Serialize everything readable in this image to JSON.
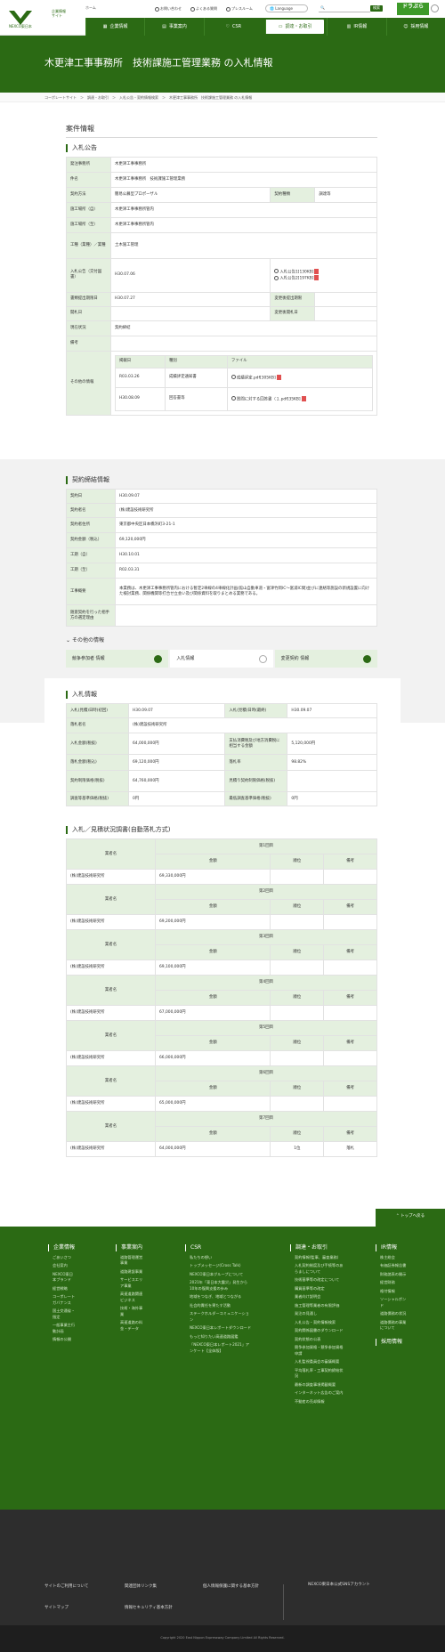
{
  "header": {
    "logo_text": "NEXCO東日本",
    "corp_info": "企業情報",
    "corp_sub": "サイト",
    "home_label": "ホーム",
    "links": [
      "お問い合わせ",
      "よくある質問",
      "プレスルーム"
    ],
    "language": "Language",
    "search_label": "検索",
    "dorapura": "ドラぷら",
    "nav": [
      "企業情報",
      "事業案内",
      "CSR",
      "調達・お取引",
      "IR情報",
      "採用情報"
    ]
  },
  "hero": {
    "title": "木更津工事事務所　技術課施工管理業務 の入札情報"
  },
  "breadcrumb": "コーポレートサイト　＞　調達・お取引　＞　入札公告・契約情報検索　＞　木更津工事事務所　技術課施工管理業務 の入札情報",
  "case": {
    "title": "案件情報",
    "announce_title": "入札公告",
    "rows": {
      "office": [
        "発注事務所",
        "木更津工事事務所"
      ],
      "name": [
        "件名",
        "木更津工事事務所　技術課施工管理業務"
      ],
      "method": [
        "契約方法",
        "簡易公募型プロポーザル"
      ],
      "type": [
        "契約種類",
        "調達等"
      ],
      "place_start": [
        "施工場所（自）",
        "木更津工事事務所管内"
      ],
      "place_end": [
        "施工場所（至）",
        "木更津工事事務所管内"
      ],
      "category": [
        "工種（業種）／業種",
        "土木施工管理"
      ],
      "announce": [
        "入札公告（交付図書）",
        "H30.07.06"
      ],
      "files": [
        "入札公告1[130KB]",
        "入札公告2[197KB]"
      ],
      "doc_open": [
        "書類提出期限日",
        "H30.07.27"
      ],
      "change_doc": [
        "変更後提出期限",
        ""
      ],
      "open_day": [
        "開札日",
        ""
      ],
      "change_open": [
        "変更後開札日",
        ""
      ],
      "status": [
        "現在状況",
        "契約締結"
      ],
      "note": [
        "備考",
        ""
      ],
      "other": "その他の情報"
    },
    "other_head": [
      "掲載日",
      "種別",
      "ファイル"
    ],
    "other_rows": [
      {
        "date": "R03.03.26",
        "kind": "成績評定通知書",
        "file": "成績評定.pdf[305KB]"
      },
      {
        "date": "H30.08.09",
        "kind": "回答書等",
        "file": "質問に対する回答書（１.pdf[35KB]"
      }
    ]
  },
  "contract": {
    "title": "契約締結情報",
    "rows": [
      [
        "契約日",
        "H30.09.07"
      ],
      [
        "契約者名",
        "(株)建設技術研究所"
      ],
      [
        "契約者住所",
        "東京都中央区日本橋浜町3-21-1"
      ],
      [
        "契約金額（税込）",
        "69,120,000円"
      ],
      [
        "工期（自）",
        "H30.10.01"
      ],
      [
        "工期（至）",
        "R02.03.31"
      ],
      [
        "工事概要",
        "本業務は、木更津工事事務所管内における暫定2車線の4車線化計画(館山自動車道・富津竹岡IC～富浦IC間)並びに連絡等施設の新規設置に向けた検討業務、関係機関等打合せ立会い及び関係資料を取りまとめる業務である。"
      ],
      [
        "随意契約を行った相手方の選定理由",
        ""
      ]
    ]
  },
  "other": {
    "title": "その他の情報",
    "tabs": [
      "競争参加者 情報",
      "入札情報",
      "変更契約 情報"
    ],
    "bid_title": "入札情報",
    "bid_rows": [
      [
        "入札(見積)日時(初回)",
        "H30.09.07",
        "入札(見積)日時(最終)",
        "H30.09.07"
      ],
      [
        "落札者名",
        "(株)建設技術研究所",
        "",
        ""
      ],
      [
        "入札金額(税抜)",
        "64,000,000円",
        "支払消費税及び地方消費税に相当する金額",
        "5,120,000円"
      ],
      [
        "落札金額(税込)",
        "69,120,000円",
        "落札率",
        "98.82%"
      ],
      [
        "契約制限価格(税抜)",
        "64,760,000円",
        "見積り契約制限価格(税抜)",
        ""
      ],
      [
        "調査等基準価格(税抜)",
        "0円",
        "最低調査基準価格(税抜)",
        "0円"
      ]
    ],
    "result_title": "入札／見積状況調書(自動落札方式)",
    "result_cols": [
      "業者名",
      "金額",
      "順位",
      "備考"
    ],
    "rounds": [
      {
        "label": "第1回目",
        "company": "(株)建設技術研究所",
        "amount": "69,330,000円",
        "rank": "",
        "note": ""
      },
      {
        "label": "第2回目",
        "company": "(株)建設技術研究所",
        "amount": "69,200,000円",
        "rank": "",
        "note": ""
      },
      {
        "label": "第3回目",
        "company": "(株)建設技術研究所",
        "amount": "69,100,000円",
        "rank": "",
        "note": ""
      },
      {
        "label": "第4回目",
        "company": "(株)建設技術研究所",
        "amount": "67,000,000円",
        "rank": "",
        "note": ""
      },
      {
        "label": "第5回目",
        "company": "(株)建設技術研究所",
        "amount": "66,000,000円",
        "rank": "",
        "note": ""
      },
      {
        "label": "第6回目",
        "company": "(株)建設技術研究所",
        "amount": "65,000,000円",
        "rank": "",
        "note": ""
      },
      {
        "label": "第7回目",
        "company": "(株)建設技術研究所",
        "amount": "64,000,000円",
        "rank": "1位",
        "note": "落札"
      }
    ]
  },
  "footer": {
    "top_button": "トップへ戻る",
    "cols": [
      {
        "title": "企業情報",
        "items": [
          "ごあいさつ",
          "会社案内",
          "NEXCO東日本ブランド",
          "経営戦略",
          "コーポレートガバナンス",
          "国土交通省・指定",
          "一般事業主行動計画",
          "情報の公開"
        ]
      },
      {
        "title": "事業案内",
        "items": [
          "道路管理運営事業",
          "道路建設事業",
          "サービスエリア事業",
          "高速道路関連ビジネス",
          "技術・海外事業",
          "高速道路の料金・データ"
        ]
      },
      {
        "title": "CSR",
        "items": [
          "私たちの想い",
          "トップメッセージ(Cross Talk)",
          "NEXCO東日本グループについて",
          "2021年「東日本大震災」発生から10年の復興支援の歩み",
          "地域をつなぎ、地域とつながる",
          "社会的責任を果たす活動",
          "ステークホルダーコミュニケーション",
          "NEXCO東日本レポートダウンロード",
          "もっと知りたい高速道路図鑑",
          "「NEXCO東日本レポート2021」アンケート【全体版】"
        ]
      },
      {
        "title": "調達・お取引",
        "items": [
          "契約情報(監事、審査業務)",
          "入札契約制度及び手続等のあらましについて",
          "技術基準等の改定について",
          "購買基準等の改定",
          "業者向け説明会",
          "施工管理等業者の有限評価",
          "発注の見通し",
          "入札公告・契約情報検索",
          "契約関係図書のダウンロード",
          "契約状態の公表",
          "競争参加資格・競争参加資格申請",
          "入札監視委員会の審議概要",
          "平均落札率・工事契約締結状況",
          "最新の調査事項掲載概要",
          "インターネット広告のご案内",
          "不動産の売却情報"
        ]
      },
      {
        "title": "IR情報",
        "items": [
          "株主総会",
          "有価証券報告書",
          "財務諸表の開示",
          "経営財務",
          "格付情報",
          "ソーシャルボンド",
          "道路債務の状況",
          "道路債務の事業について"
        ]
      }
    ],
    "recruit": "採用情報",
    "bottom_links": [
      "サイトのご利用について",
      "関連団体リンク集",
      "個人情報保護に関する基本方針",
      "サイトマップ",
      "情報セキュリティ基本方針"
    ],
    "sns": "NEXCO東日本公式SNSアカウント",
    "copyright": "Copyright 2020 East Nippon Expressway Company Limited All Rights Reserved."
  }
}
